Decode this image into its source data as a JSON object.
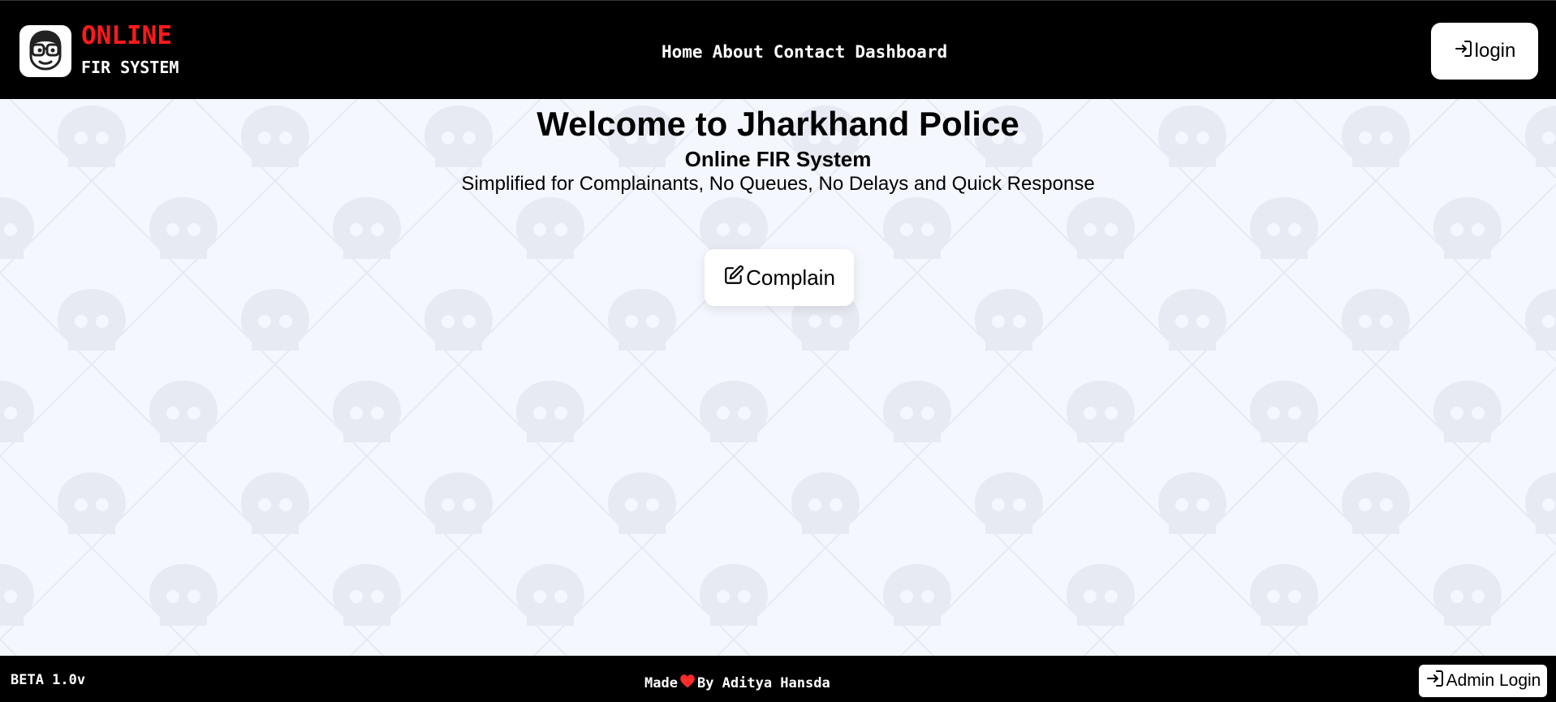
{
  "header": {
    "brand_top": "ONLINE",
    "brand_bottom": "FIR SYSTEM",
    "nav": [
      "Home",
      "About",
      "Contact",
      "Dashboard"
    ],
    "login_label": "login"
  },
  "hero": {
    "title": "Welcome to Jharkhand Police",
    "subtitle": "Online FIR System",
    "tagline": "Simplified for Complainants, No Queues, No Delays and Quick Response",
    "complain_label": "Complain"
  },
  "footer": {
    "version": "BETA 1.0v",
    "made_prefix": "Made",
    "made_suffix": "By Aditya Hansda",
    "admin_login_label": "Admin Login"
  },
  "icons": {
    "logo": "nerd-face-icon",
    "login": "sign-in-icon",
    "complain": "edit-square-icon",
    "heart": "heart-icon",
    "admin_login": "sign-in-icon"
  },
  "colors": {
    "brand_accent": "#ff1a1a",
    "header_bg": "#000000",
    "page_bg": "#f4f7fe",
    "heart": "#ff2b2b"
  }
}
